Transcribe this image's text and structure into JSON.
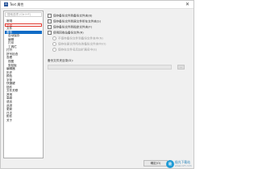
{
  "window": {
    "title": "Text 属性",
    "app_icon": "W",
    "close": "✕"
  },
  "left_panel": {
    "search_placeholder": "搜索选项 (Ctrl+F)",
    "items": [
      "常规",
      "外观",
      "文件",
      "备份",
      "自动保存",
      "编辑",
      "打印",
      "工具栏",
      "打开",
      "拼写检查",
      "查看",
      "视图",
      "剪贴板",
      "编辑器",
      "历史",
      "颜色",
      "字体",
      "快捷键",
      "插件",
      "文件关联",
      "其他",
      "高级",
      "语言",
      "选项",
      "更新",
      "日志",
      "附件",
      "关于"
    ],
    "selected_index": 3,
    "highlighted_index": 1
  },
  "options": [
    {
      "label": "保存备份文件到备份文件夹(B)"
    },
    {
      "label": "保存备份文件到原文件所在文件夹(S)"
    },
    {
      "label": "保存备份文件到指定文件夹(F)"
    },
    {
      "label": "使用回收站备份文件(R)"
    }
  ],
  "sub_options": [
    {
      "label": "不保存备份文件到备份文件夹中(N)"
    },
    {
      "label": "保存在原文件所在的备份文件夹中(O)"
    },
    {
      "label": "保存在文件名后加扩展名中(E)"
    }
  ],
  "backup_folder": {
    "label": "备份文件夹目录(D):",
    "value": "",
    "browse": "..."
  },
  "buttons": {
    "ok": "确定(O)"
  },
  "watermark": {
    "logo": "极",
    "text": "极光下载站",
    "url": "www.xz7.com"
  }
}
